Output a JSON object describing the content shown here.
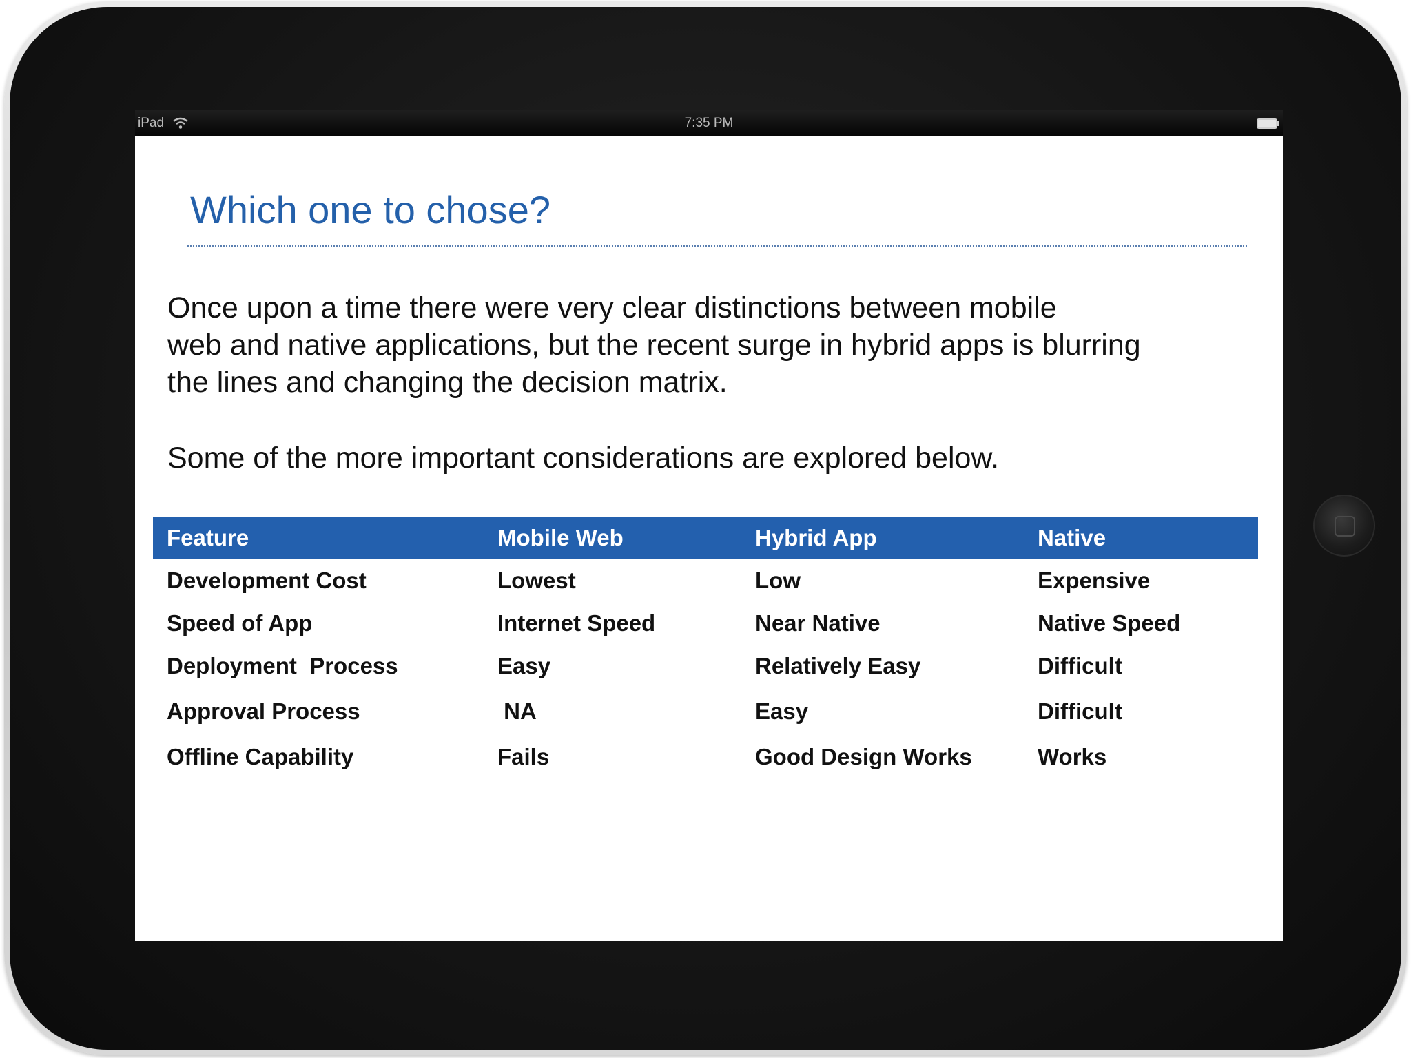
{
  "status_bar": {
    "device_label": "iPad",
    "time": "7:35 PM"
  },
  "slide": {
    "title": "Which one to chose?",
    "intro_lines": [
      "Once upon a time there were very clear distinctions between mobile",
      "web and native applications, but the recent surge in hybrid apps is blurring",
      "the lines and changing the decision matrix."
    ],
    "subtext": "Some of the more important considerations are explored below."
  },
  "table": {
    "headers": [
      "Feature",
      "Mobile Web",
      "Hybrid App",
      "Native"
    ],
    "rows": [
      [
        "Development Cost",
        "Lowest",
        "Low",
        "Expensive"
      ],
      [
        "Speed of App",
        "Internet Speed",
        "Near Native",
        "Native Speed"
      ],
      [
        "Deployment  Process",
        "Easy",
        "Relatively Easy",
        "Difficult"
      ],
      [
        "Approval Process",
        " NA",
        "Easy",
        "Difficult"
      ],
      [
        "Offline Capability",
        "Fails",
        "Good Design Works",
        "Works"
      ]
    ]
  },
  "colors": {
    "accent": "#2460aa",
    "header_bg": "#2360ae",
    "bezel": "#151515"
  },
  "icons": {
    "wifi": "wifi-icon",
    "battery": "battery-icon",
    "home": "home-button-icon"
  }
}
